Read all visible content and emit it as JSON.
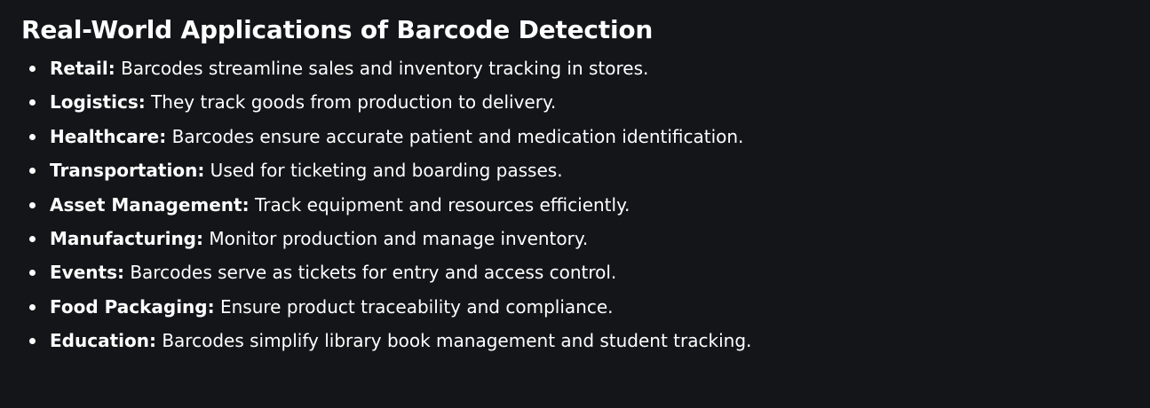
{
  "heading": "Real-World Applications of Barcode Detection",
  "items": [
    {
      "term": "Retail:",
      "text": " Barcodes streamline sales and inventory tracking in stores."
    },
    {
      "term": "Logistics:",
      "text": " They track goods from production to delivery."
    },
    {
      "term": "Healthcare:",
      "text": " Barcodes ensure accurate patient and medication identification."
    },
    {
      "term": "Transportation:",
      "text": " Used for ticketing and boarding passes."
    },
    {
      "term": "Asset Management:",
      "text": " Track equipment and resources efficiently."
    },
    {
      "term": "Manufacturing:",
      "text": " Monitor production and manage inventory."
    },
    {
      "term": "Events:",
      "text": " Barcodes serve as tickets for entry and access control."
    },
    {
      "term": "Food Packaging:",
      "text": " Ensure product traceability and compliance."
    },
    {
      "term": "Education:",
      "text": " Barcodes simplify library book management and student tracking."
    }
  ],
  "colors": {
    "background": "#141518",
    "text": "#ffffff"
  }
}
